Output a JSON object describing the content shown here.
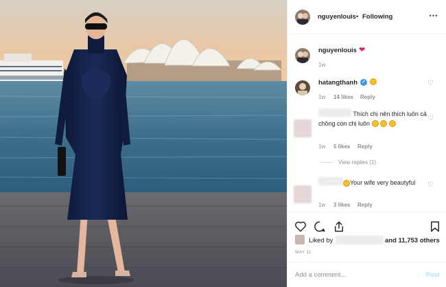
{
  "post": {
    "author": "nguyenlouis",
    "dot": "•",
    "following_label": "Following",
    "more_icon": "⋯",
    "caption_emoji": "❤",
    "caption_time": "1w"
  },
  "comments": [
    {
      "user": "hatangthanh",
      "verified": true,
      "time": "1w",
      "likes": "14 likes",
      "reply": "Reply"
    },
    {
      "text": "Thích chị nên thích luôn cả chồng con chị luôn",
      "time": "1w",
      "likes": "5 likes",
      "reply": "Reply",
      "view_replies": "View replies (1)"
    },
    {
      "text": "Your wife very beautyful",
      "time": "1w",
      "likes": "3 likes",
      "reply": "Reply"
    }
  ],
  "likes_bar": {
    "liked_by": "Liked by",
    "others": "and 11,753 others",
    "date": "MAY 11"
  },
  "comment_input": {
    "placeholder": "Add a comment...",
    "post_label": "Post"
  },
  "colors": {
    "accent_blue": "#3897f0",
    "post_disabled": "#b2dffc",
    "heart_red": "#e0245e",
    "muted": "#8e8e8e"
  }
}
